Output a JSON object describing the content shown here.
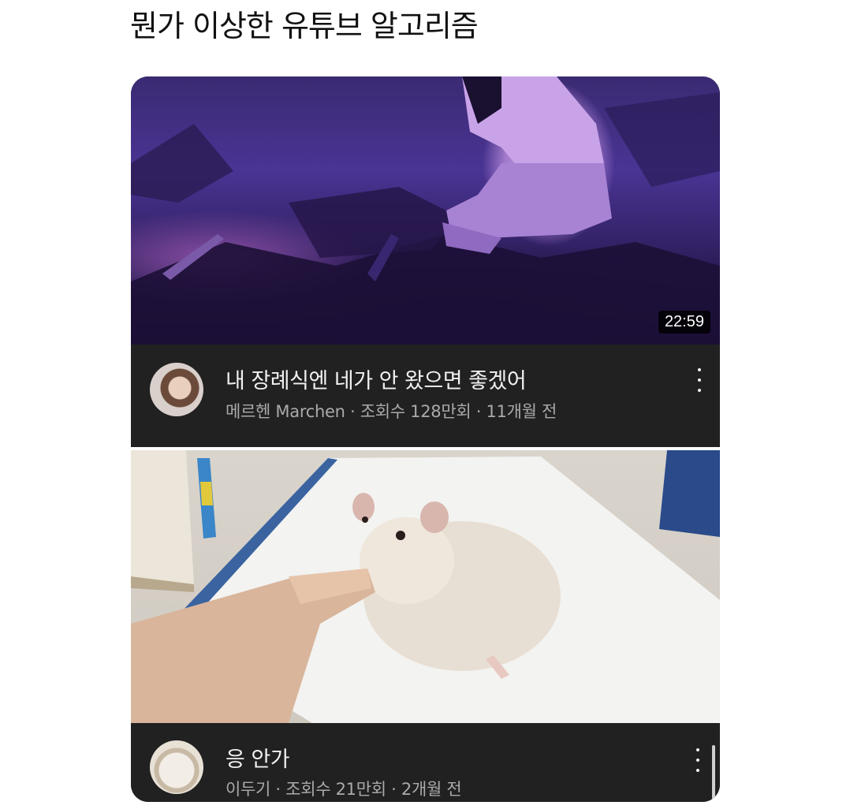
{
  "post": {
    "title": "뭔가 이상한 유튜브 알고리즘"
  },
  "videos": [
    {
      "title": "내 장례식엔 네가 안 왔으면 좋겠어",
      "meta": "메르헨 Marchen · 조회수 128만회 · 11개월 전",
      "duration": "22:59",
      "thumbnail_icon": "anime-thumbnail-icon",
      "avatar_icon": "channel-avatar-icon"
    },
    {
      "title": "응 안가",
      "meta": "이두기 · 조회수 21만회 · 2개월 전",
      "thumbnail_icon": "hamster-thumbnail-icon",
      "avatar_icon": "channel-avatar-icon"
    }
  ],
  "colors": {
    "card_bg": "#212121",
    "title_text": "#f1f1f1",
    "meta_text": "#aaaaaa"
  }
}
